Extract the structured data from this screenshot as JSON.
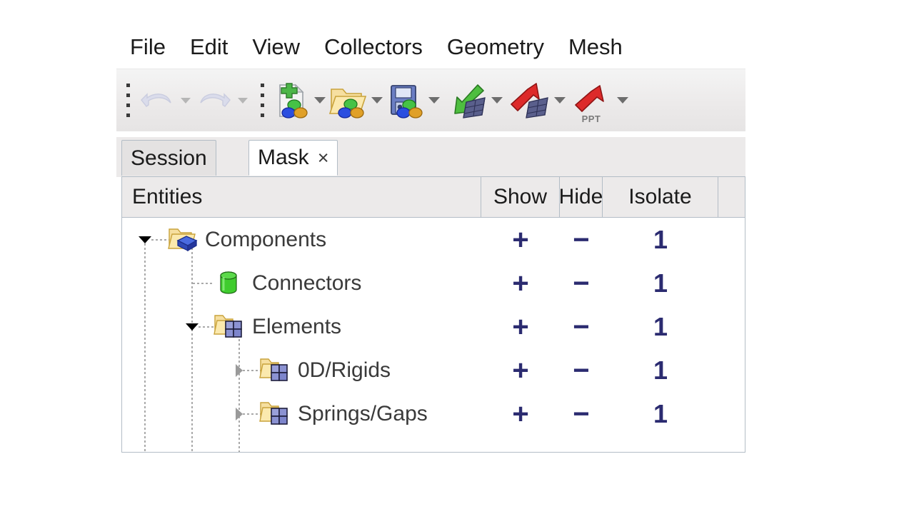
{
  "menubar": {
    "items": [
      {
        "label": "File"
      },
      {
        "label": "Edit"
      },
      {
        "label": "View"
      },
      {
        "label": "Collectors"
      },
      {
        "label": "Geometry"
      },
      {
        "label": "Mesh"
      }
    ]
  },
  "toolbar": {
    "gripper_label": "toolbar-drag-handle",
    "buttons": [
      {
        "name": "undo",
        "icon": "undo-arrow-icon",
        "enabled": false,
        "has_dropdown": true,
        "sublabel": ""
      },
      {
        "name": "redo",
        "icon": "redo-arrow-icon",
        "enabled": false,
        "has_dropdown": true,
        "sublabel": ""
      },
      {
        "name": "new-model",
        "icon": "new-file-icon",
        "enabled": true,
        "has_dropdown": true,
        "sublabel": ""
      },
      {
        "name": "open-model",
        "icon": "open-folder-icon",
        "enabled": true,
        "has_dropdown": true,
        "sublabel": ""
      },
      {
        "name": "save-model",
        "icon": "save-floppy-icon",
        "enabled": true,
        "has_dropdown": true,
        "sublabel": ""
      },
      {
        "name": "import-solver-deck",
        "icon": "import-green-arrow-icon",
        "enabled": true,
        "has_dropdown": true,
        "sublabel": ""
      },
      {
        "name": "export-solver-deck",
        "icon": "export-red-arrow-icon",
        "enabled": true,
        "has_dropdown": true,
        "sublabel": ""
      },
      {
        "name": "export-ppt",
        "icon": "export-ppt-icon",
        "enabled": true,
        "has_dropdown": true,
        "sublabel": "PPT"
      }
    ]
  },
  "tabs": [
    {
      "label": "Session",
      "active": false,
      "closable": false
    },
    {
      "label": "Mask",
      "active": true,
      "closable": true,
      "close_glyph": "×"
    }
  ],
  "columns": {
    "entities": "Entities",
    "show": "Show",
    "hide": "Hide",
    "isolate": "Isolate"
  },
  "actions": {
    "show_symbol": "+",
    "hide_symbol": "−",
    "isolate_symbol": "1",
    "color": "#2b2b70"
  },
  "tree": {
    "rows": [
      {
        "label": "Components",
        "icon": "folder-component-cube-icon",
        "depth": 0,
        "expander": "expanded",
        "show": "+",
        "hide": "−",
        "isolate": "1"
      },
      {
        "label": "Connectors",
        "icon": "green-cylinder-connector-icon",
        "depth": 1,
        "expander": "none",
        "show": "+",
        "hide": "−",
        "isolate": "1"
      },
      {
        "label": "Elements",
        "icon": "folder-mesh-element-icon",
        "depth": 1,
        "expander": "expanded",
        "show": "+",
        "hide": "−",
        "isolate": "1"
      },
      {
        "label": "0D/Rigids",
        "icon": "folder-mesh-element-icon",
        "depth": 2,
        "expander": "collapsed",
        "show": "+",
        "hide": "−",
        "isolate": "1"
      },
      {
        "label": "Springs/Gaps",
        "icon": "folder-mesh-element-icon",
        "depth": 2,
        "expander": "collapsed",
        "show": "+",
        "hide": "−",
        "isolate": "1"
      }
    ]
  }
}
